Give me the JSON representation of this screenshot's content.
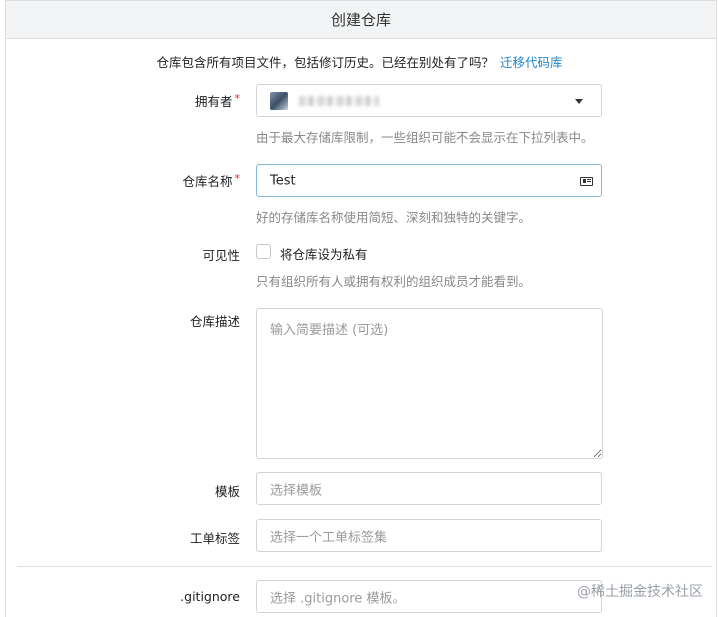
{
  "header": {
    "title": "创建仓库"
  },
  "intro": {
    "text": "仓库包含所有项目文件，包括修订历史。已经在别处有了吗？",
    "link": "迁移代码库"
  },
  "owner": {
    "label": "拥有者",
    "required_mark": "*",
    "hint": "由于最大存储库限制，一些组织可能不会显示在下拉列表中。"
  },
  "repo_name": {
    "label": "仓库名称",
    "required_mark": "*",
    "value": "Test",
    "hint": "好的存储库名称使用简短、深刻和独特的关键字。"
  },
  "visibility": {
    "label": "可见性",
    "checkbox_label": "将仓库设为私有",
    "checked": false,
    "hint": "只有组织所有人或拥有权利的组织成员才能看到。"
  },
  "description": {
    "label": "仓库描述",
    "placeholder": "输入简要描述 (可选)"
  },
  "template": {
    "label": "模板",
    "placeholder": "选择模板"
  },
  "issue_labels": {
    "label": "工单标签",
    "placeholder": "选择一个工单标签集"
  },
  "gitignore": {
    "label": ".gitignore",
    "placeholder": "选择 .gitignore 模板。"
  },
  "watermark": "@稀土掘金技术社区",
  "icons": {
    "owner_dropdown": "chevron-down-icon",
    "autofill": "contact-card-icon"
  }
}
